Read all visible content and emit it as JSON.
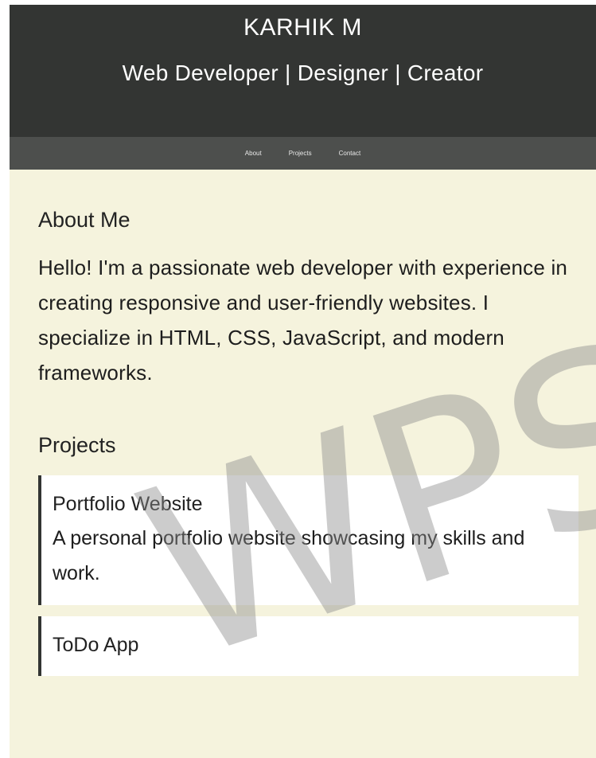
{
  "header": {
    "name": "KARHIK M",
    "tagline": "Web Developer | Designer | Creator"
  },
  "nav": {
    "items": [
      "About",
      "Projects",
      "Contact"
    ]
  },
  "about": {
    "heading": "About Me",
    "text": "Hello! I'm a passionate web developer with experience in creating responsive and user-friendly websites. I specialize in HTML, CSS, JavaScript, and modern frameworks."
  },
  "projects": {
    "heading": "Projects",
    "items": [
      {
        "title": "Portfolio Website",
        "description": "A personal portfolio website showcasing my skills and work."
      },
      {
        "title": "ToDo App",
        "description": ""
      }
    ]
  },
  "watermark": {
    "text": "WPS"
  },
  "colors": {
    "header_bg": "#333533",
    "nav_bg": "#4d4f4d",
    "page_bg": "#f5f3dd",
    "card_bg": "#ffffff"
  }
}
